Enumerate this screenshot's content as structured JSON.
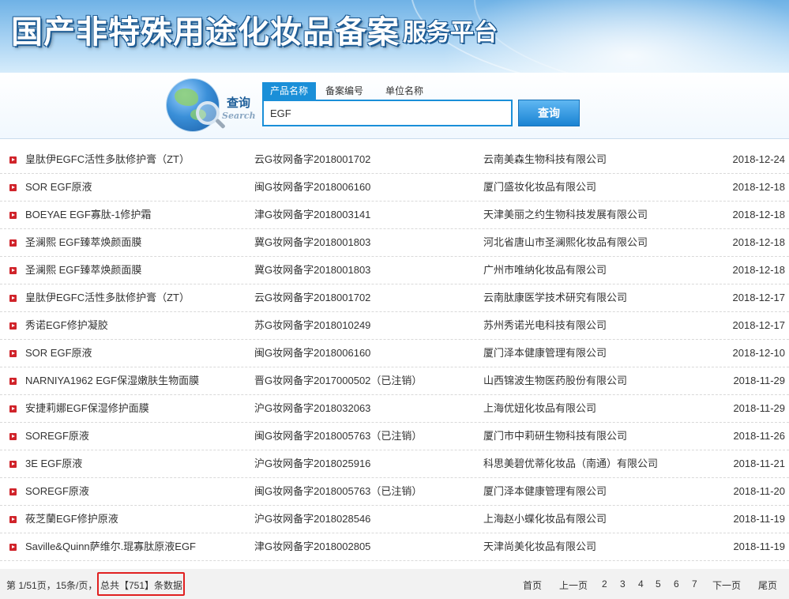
{
  "header": {
    "title": "国产非特殊用途化妆品备案",
    "subtitle": "服务平台"
  },
  "search": {
    "label_cn": "查询",
    "label_en": "Search",
    "tabs": [
      "产品名称",
      "备案编号",
      "单位名称"
    ],
    "active_tab": "产品名称",
    "value": "EGF",
    "button_label": "查询"
  },
  "results": [
    {
      "name": "皇肽伊EGFC活性多肽修护膏（ZT）",
      "code": "云G妆网备字2018001702",
      "company": "云南美森生物科技有限公司",
      "date": "2018-12-24"
    },
    {
      "name": "SOR EGF原液",
      "code": "闽G妆网备字2018006160",
      "company": "厦门盛妆化妆品有限公司",
      "date": "2018-12-18"
    },
    {
      "name": "BOEYAE EGF寡肽-1修护霜",
      "code": "津G妆网备字2018003141",
      "company": "天津美丽之约生物科技发展有限公司",
      "date": "2018-12-18"
    },
    {
      "name": "圣澜熙 EGF臻萃焕颜面膜",
      "code": "冀G妆网备字2018001803",
      "company": "河北省唐山市圣澜熙化妆品有限公司",
      "date": "2018-12-18"
    },
    {
      "name": "圣澜熙 EGF臻萃焕颜面膜",
      "code": "冀G妆网备字2018001803",
      "company": "广州市唯纳化妆品有限公司",
      "date": "2018-12-18"
    },
    {
      "name": "皇肽伊EGFC活性多肽修护膏（ZT）",
      "code": "云G妆网备字2018001702",
      "company": "云南肽康医学技术研究有限公司",
      "date": "2018-12-17"
    },
    {
      "name": "秀诺EGF修护凝胶",
      "code": "苏G妆网备字2018010249",
      "company": "苏州秀诺光电科技有限公司",
      "date": "2018-12-17"
    },
    {
      "name": "SOR EGF原液",
      "code": "闽G妆网备字2018006160",
      "company": "厦门泽本健康管理有限公司",
      "date": "2018-12-10"
    },
    {
      "name": "NARNIYA1962 EGF保湿嫩肤生物面膜",
      "code": "晋G妆网备字2017000502（已注销）",
      "company": "山西锦波生物医药股份有限公司",
      "date": "2018-11-29"
    },
    {
      "name": "安捷莉娜EGF保湿修护面膜",
      "code": "沪G妆网备字2018032063",
      "company": "上海优妞化妆品有限公司",
      "date": "2018-11-29"
    },
    {
      "name": "SOREGF原液",
      "code": "闽G妆网备字2018005763（已注销）",
      "company": "厦门市中莉研生物科技有限公司",
      "date": "2018-11-26"
    },
    {
      "name": "3E EGF原液",
      "code": "沪G妆网备字2018025916",
      "company": "科思美碧优蒂化妆品（南通）有限公司",
      "date": "2018-11-21"
    },
    {
      "name": "SOREGF原液",
      "code": "闽G妆网备字2018005763（已注销）",
      "company": "厦门泽本健康管理有限公司",
      "date": "2018-11-20"
    },
    {
      "name": "莜芝蘭EGF修护原液",
      "code": "沪G妆网备字2018028546",
      "company": "上海赵小蝶化妆品有限公司",
      "date": "2018-11-19"
    },
    {
      "name": "Saville&Quinn萨维尔.琨寡肽原液EGF",
      "code": "津G妆网备字2018002805",
      "company": "天津尚美化妆品有限公司",
      "date": "2018-11-19"
    }
  ],
  "footer": {
    "page_info": "第 1/51页，15条/页，",
    "total_text": "总共【751】条数据",
    "first": "首页",
    "prev": "上一页",
    "pages": [
      "2",
      "3",
      "4",
      "5",
      "6",
      "7"
    ],
    "next": "下一页",
    "last": "尾页"
  },
  "colors": {
    "accent": "#1a8fd8",
    "bullet": "#d0232a",
    "highlight_box": "#e02020"
  }
}
